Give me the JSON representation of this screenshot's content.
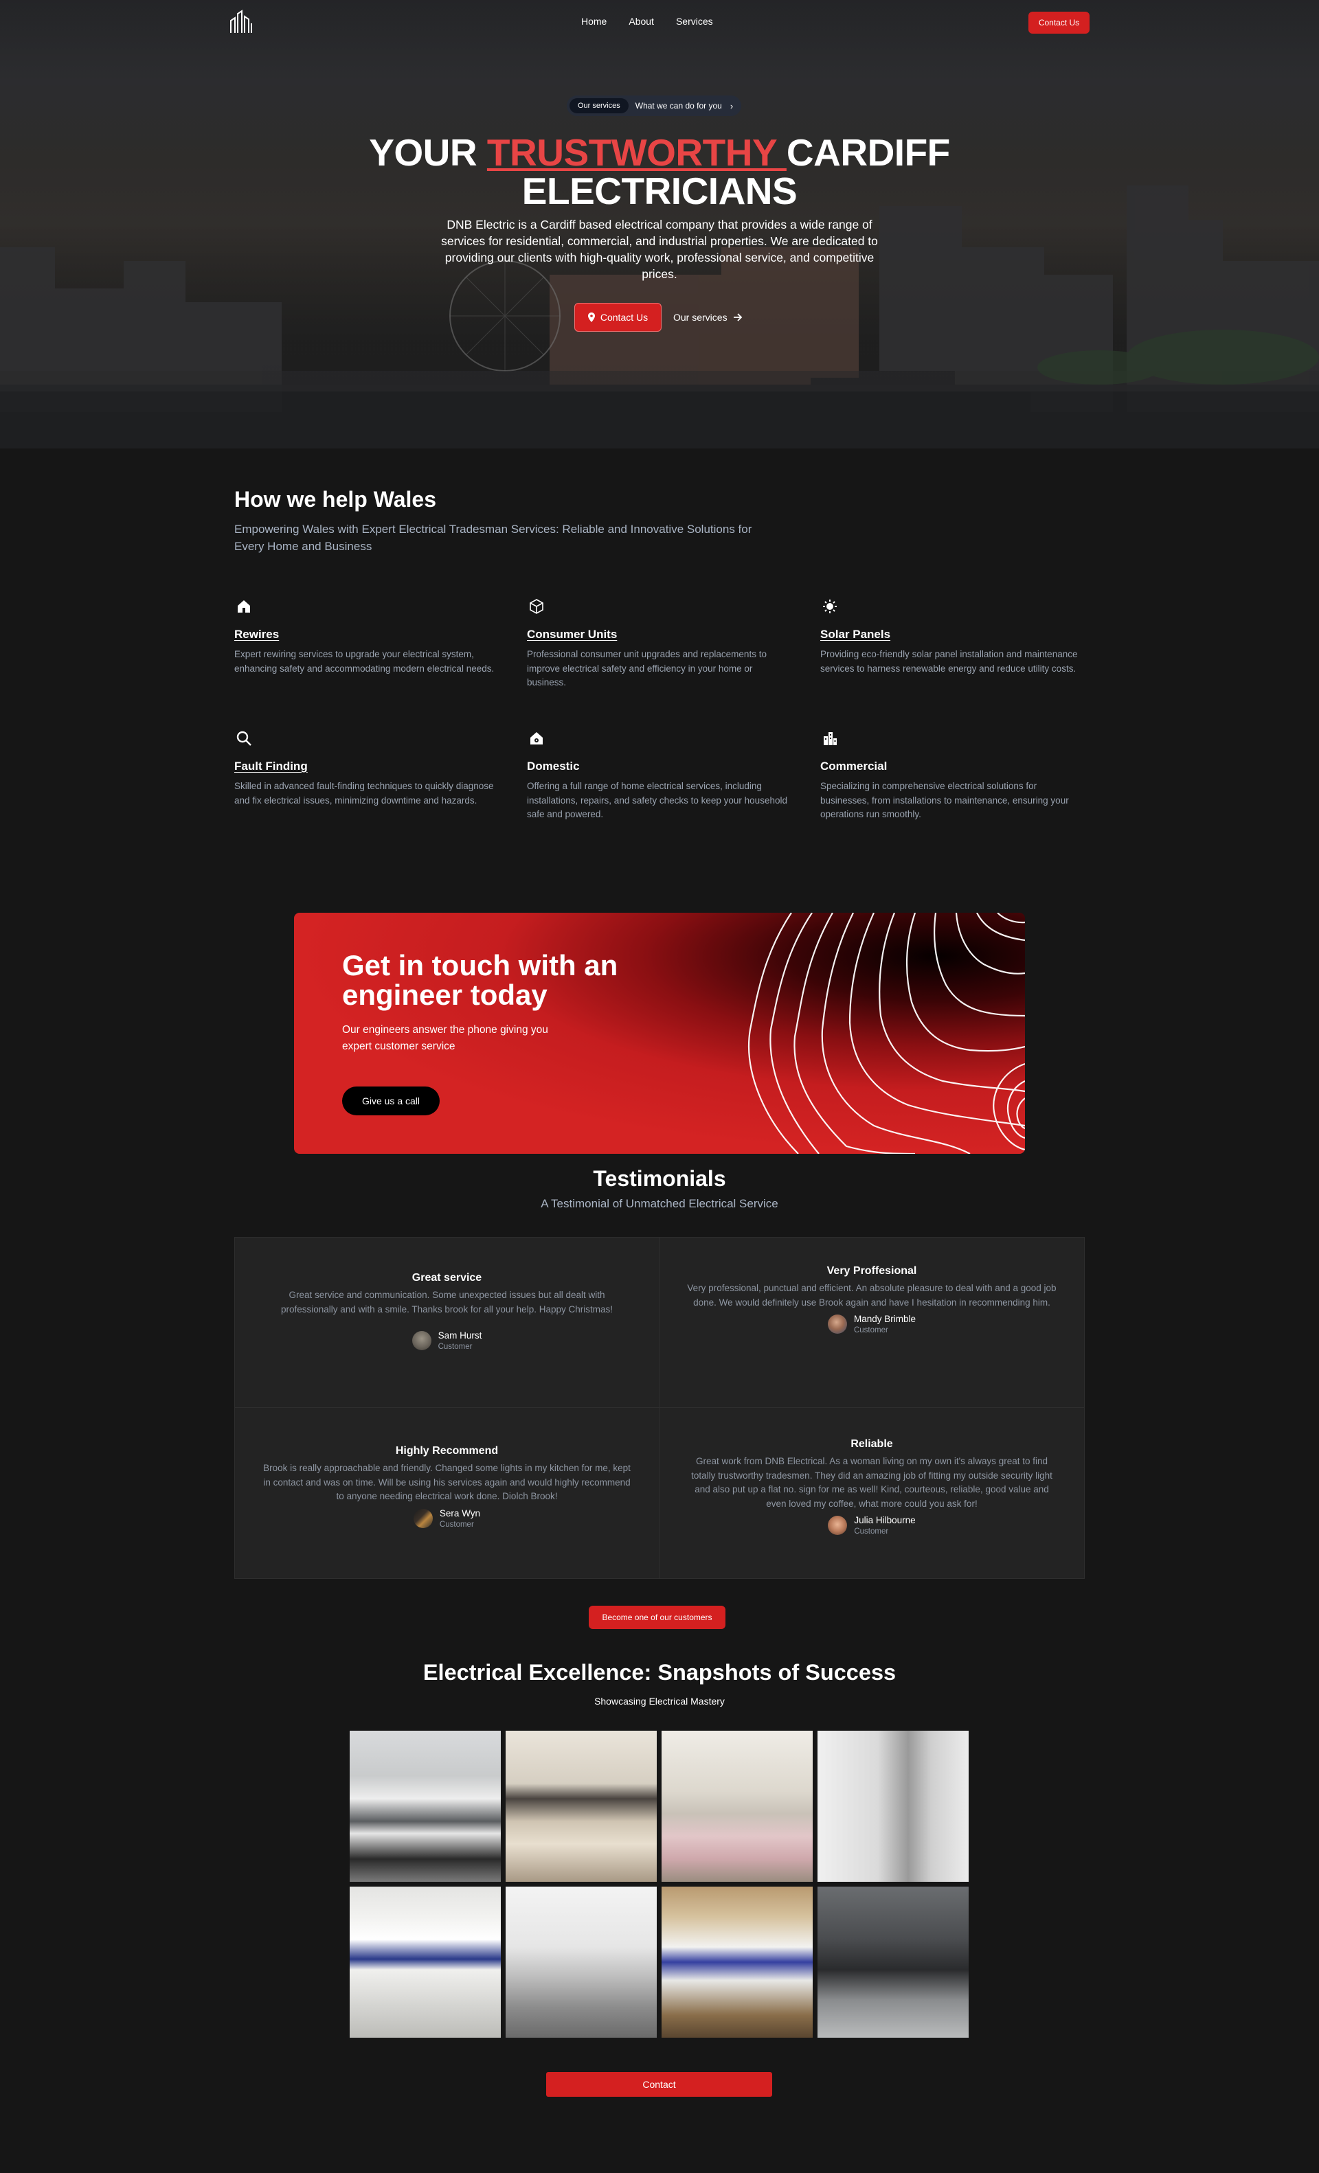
{
  "nav": {
    "logo_icon": "dnb-logo-icon",
    "links": [
      "Home",
      "About",
      "Services"
    ],
    "cta": "Contact Us"
  },
  "hero": {
    "pill_tag": "Our services",
    "pill_text": "What we can do for you",
    "title_pre": "YOUR ",
    "title_accent": "TRUSTWORTHY ",
    "title_post": "CARDIFF ELECTRICIANS",
    "subtitle": "DNB Electric is a Cardiff based electrical company that provides a wide range of services for residential, commercial, and industrial properties. We are dedicated to providing our clients with high-quality work, professional service, and competitive prices.",
    "primary_btn": "Contact Us",
    "secondary_btn": "Our services",
    "accent_color": "#e84545"
  },
  "help": {
    "title": "How we help Wales",
    "subtitle": "Empowering Wales with Expert Electrical Tradesman Services: Reliable and Innovative Solutions for Every Home and Business",
    "services": [
      {
        "icon": "home-icon",
        "title": "Rewires",
        "desc": "Expert rewiring services to upgrade your electrical system, enhancing safety and accommodating modern electrical needs."
      },
      {
        "icon": "cube-icon",
        "title": "Consumer Units",
        "desc": "Professional consumer unit upgrades and replacements to improve electrical safety and efficiency in your home or business."
      },
      {
        "icon": "sun-icon",
        "title": "Solar Panels",
        "desc": "Providing eco-friendly solar panel installation and maintenance services to harness renewable energy and reduce utility costs."
      },
      {
        "icon": "search-icon",
        "title": "Fault Finding",
        "desc": "Skilled in advanced fault-finding techniques to quickly diagnose and fix electrical issues, minimizing downtime and hazards."
      },
      {
        "icon": "house-gear-icon",
        "title": "Domestic",
        "desc": "Offering a full range of home electrical services, including installations, repairs, and safety checks to keep your household safe and powered."
      },
      {
        "icon": "buildings-icon",
        "title": "Commercial",
        "desc": "Specializing in comprehensive electrical solutions for businesses, from installations to maintenance, ensuring your operations run smoothly."
      }
    ]
  },
  "cta": {
    "title": "Get in touch with an engineer today",
    "text": "Our engineers answer the phone giving you expert customer service",
    "button": "Give us a call",
    "bg_color": "#d42323"
  },
  "testimonials": {
    "title": "Testimonials",
    "subtitle": "A Testimonial of Unmatched Electrical Service",
    "items": [
      {
        "title": "Great service",
        "text": "Great service and communication. Some unexpected issues but all dealt with professionally and with a smile. Thanks brook for all your help. Happy Christmas!",
        "name": "Sam Hurst",
        "role": "Customer"
      },
      {
        "title": "Very Proffesional",
        "text": "Very professional, punctual and efficient. An absolute pleasure to deal with and a good job done. We would definitely use Brook again and have I hesitation in recommending him.",
        "name": "Mandy Brimble",
        "role": "Customer"
      },
      {
        "title": "Highly Recommend",
        "text": "Brook is really approachable and friendly. Changed some lights in my kitchen for me, kept in contact and was on time. Will be using his services again and would highly recommend to anyone needing electrical work done. Diolch Brook!",
        "name": "Sera Wyn",
        "role": "Customer"
      },
      {
        "title": "Reliable",
        "text": "Great work from DNB Electrical. As a woman living on my own it's always great to find totally trustworthy tradesmen. They did an amazing job of fitting my outside security light and also put up a flat no. sign for me as well! Kind, courteous, reliable, good value and even loved my coffee, what more could you ask for!",
        "name": "Julia Hilbourne",
        "role": "Customer"
      }
    ],
    "button": "Become one of our customers"
  },
  "gallery": {
    "title": "Electrical Excellence: Snapshots of Success",
    "subtitle": "Showcasing Electrical Mastery",
    "photos": [
      "kitchen-photo",
      "living-room-photo",
      "bedroom-photo",
      "hallway-photo",
      "consumer-unit-photo",
      "empty-room-photo",
      "fuse-board-photo",
      "dark-kitchen-photo"
    ],
    "button": "Contact"
  }
}
